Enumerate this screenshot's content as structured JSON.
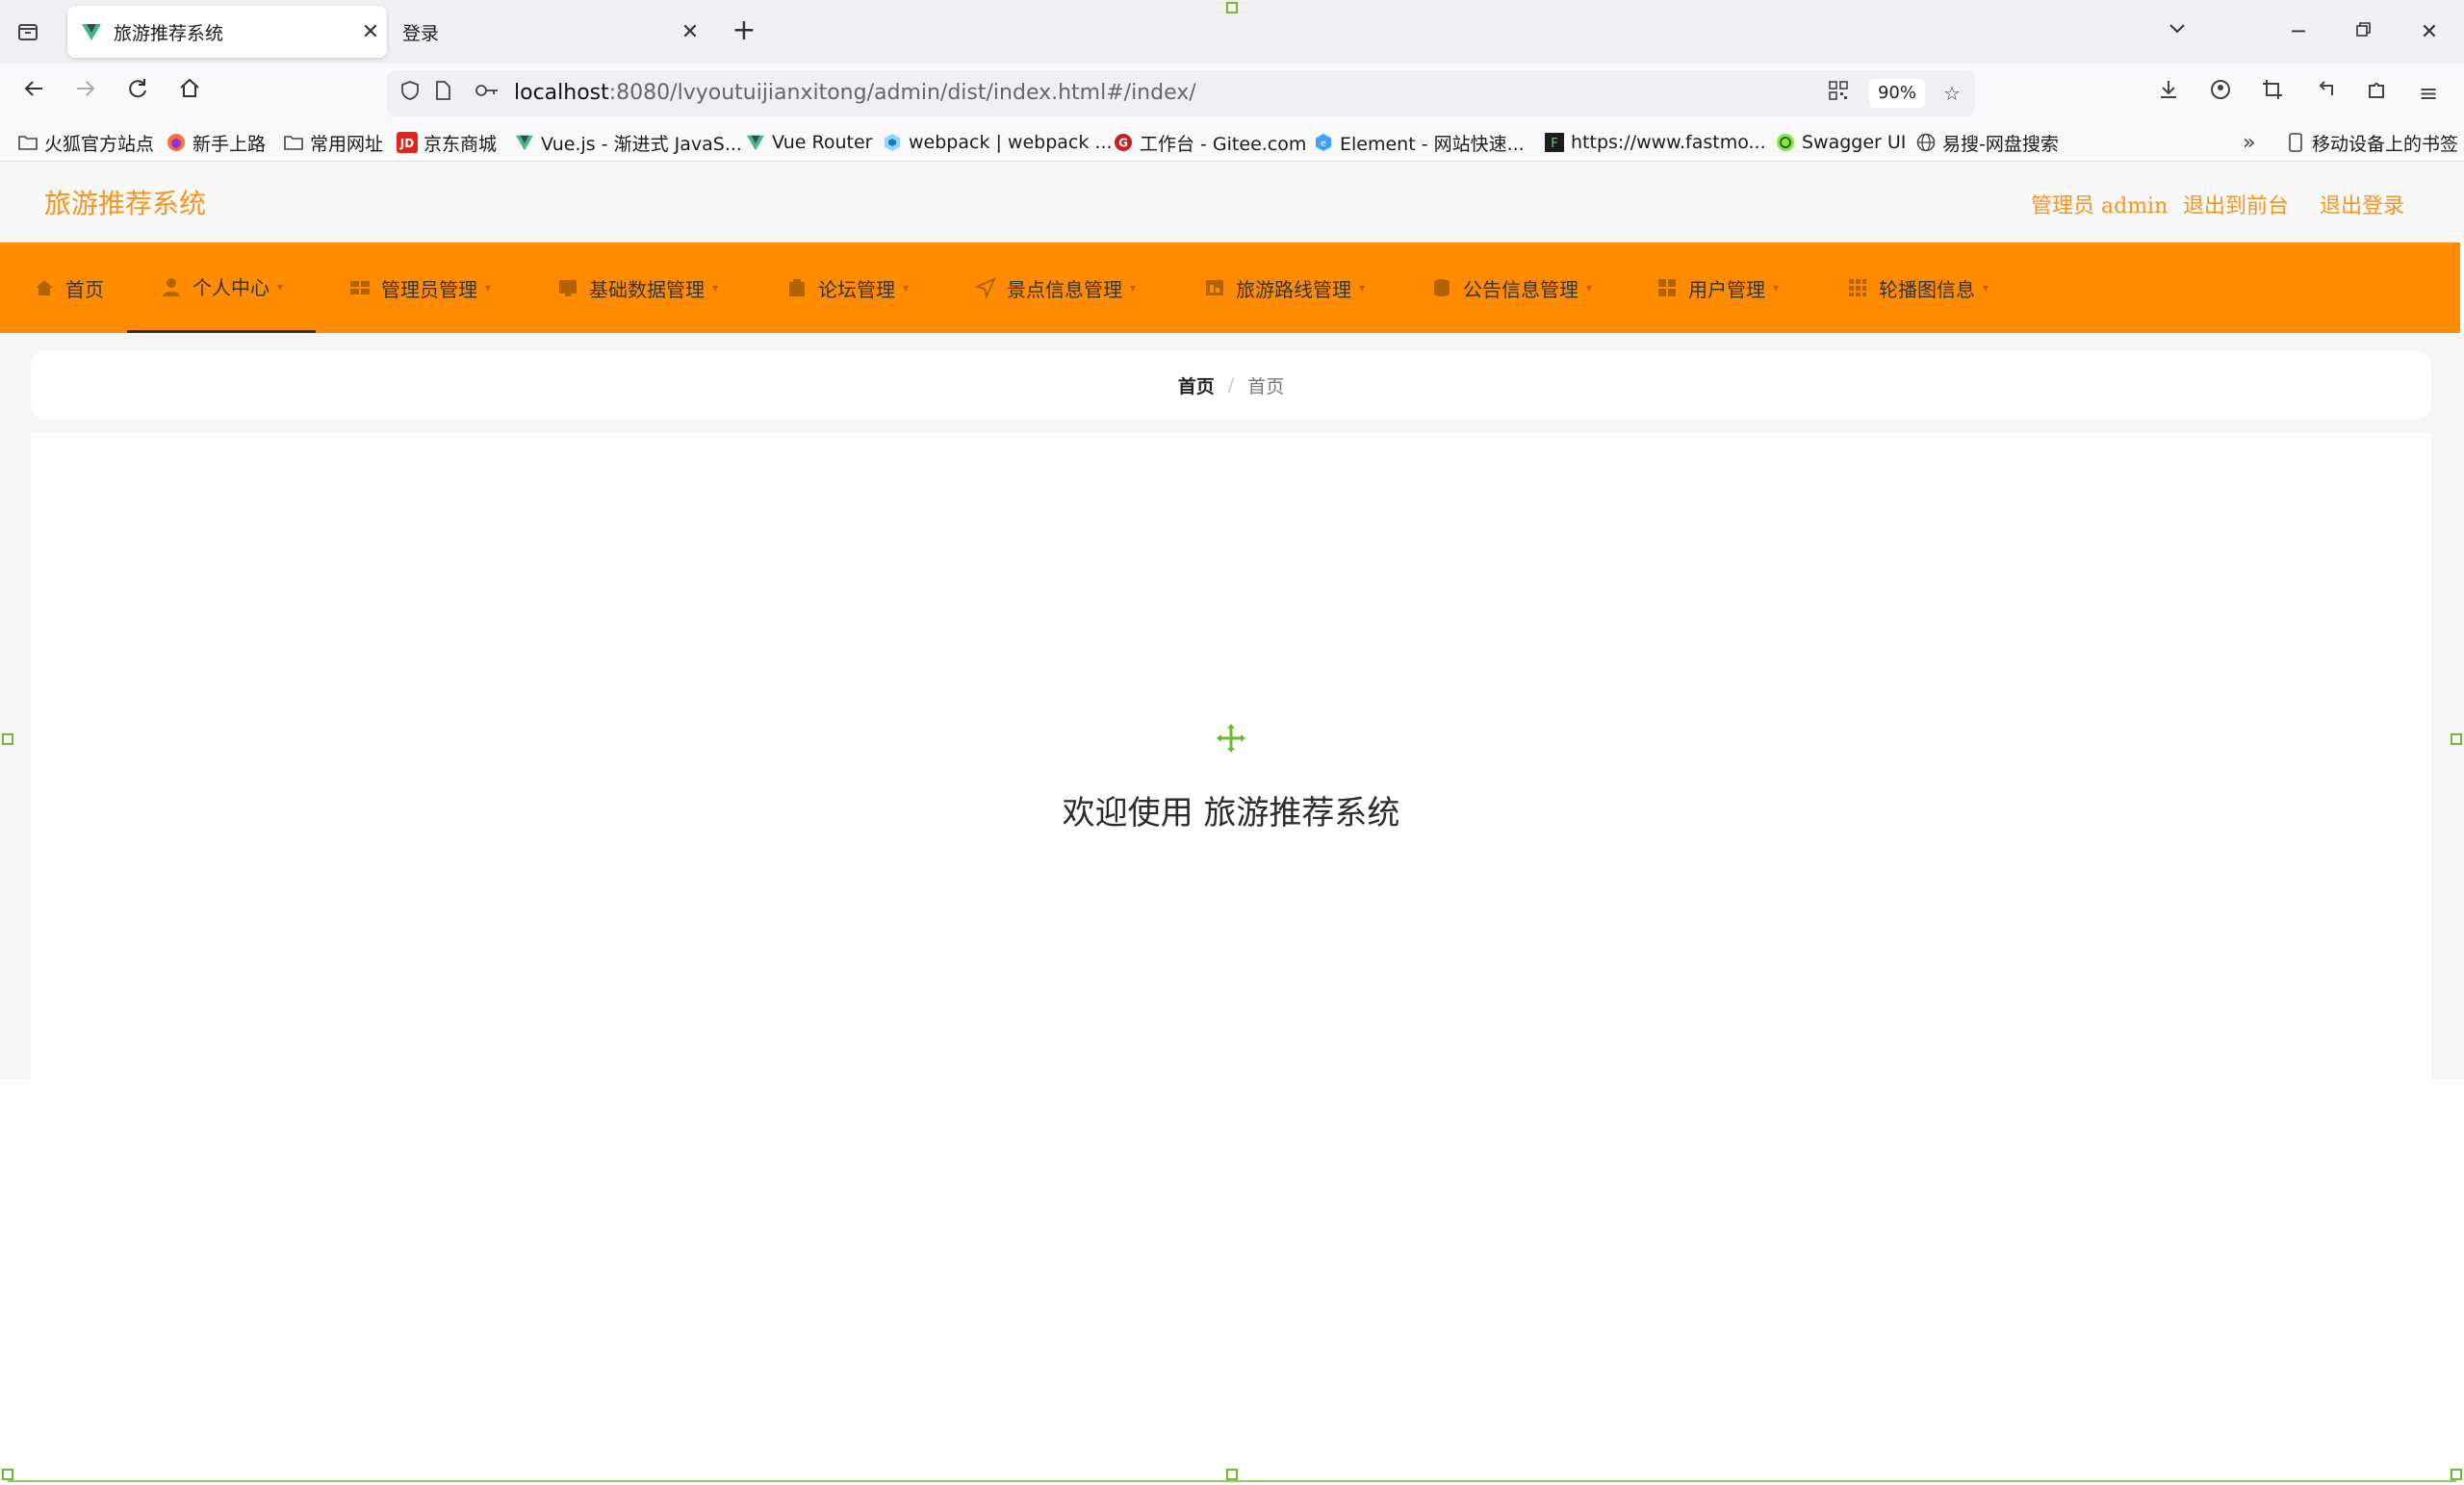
{
  "browser": {
    "tabs": [
      {
        "title": "旅游推荐系统",
        "active": true
      },
      {
        "title": "登录",
        "active": false
      }
    ],
    "url": {
      "host": "localhost",
      "path": ":8080/lvyoutuijianxitong/admin/dist/index.html#/index/"
    },
    "zoom": "90%",
    "bookmarks": [
      {
        "label": "火狐官方站点",
        "icon": "folder-icon"
      },
      {
        "label": "新手上路",
        "icon": "firefox-icon"
      },
      {
        "label": "常用网址",
        "icon": "folder-icon"
      },
      {
        "label": "京东商城",
        "icon": "jd-icon"
      },
      {
        "label": "Vue.js - 渐进式 JavaS...",
        "icon": "vue-icon"
      },
      {
        "label": "Vue Router",
        "icon": "vue-icon"
      },
      {
        "label": "webpack | webpack ...",
        "icon": "webpack-icon"
      },
      {
        "label": "工作台 - Gitee.com",
        "icon": "gitee-icon"
      },
      {
        "label": "Element - 网站快速...",
        "icon": "element-icon"
      },
      {
        "label": "https://www.fastmo...",
        "icon": "fastmock-icon"
      },
      {
        "label": "Swagger UI",
        "icon": "swagger-icon"
      },
      {
        "label": "易搜-网盘搜索",
        "icon": "globe-icon"
      }
    ],
    "mobile_bookmarks": "移动设备上的书签"
  },
  "app": {
    "brand": "旅游推荐系统",
    "header_links": {
      "user": "管理员 admin",
      "front": "退出到前台",
      "logout": "退出登录"
    },
    "menu": [
      {
        "label": "首页",
        "icon": "home-icon",
        "has_caret": false
      },
      {
        "label": "个人中心",
        "icon": "user-icon",
        "has_caret": true,
        "active": true
      },
      {
        "label": "管理员管理",
        "icon": "admin-icon",
        "has_caret": true
      },
      {
        "label": "基础数据管理",
        "icon": "data-icon",
        "has_caret": true
      },
      {
        "label": "论坛管理",
        "icon": "forum-icon",
        "has_caret": true
      },
      {
        "label": "景点信息管理",
        "icon": "location-icon",
        "has_caret": true
      },
      {
        "label": "旅游路线管理",
        "icon": "route-icon",
        "has_caret": true
      },
      {
        "label": "公告信息管理",
        "icon": "notice-icon",
        "has_caret": true
      },
      {
        "label": "用户管理",
        "icon": "users-icon",
        "has_caret": true
      },
      {
        "label": "轮播图信息",
        "icon": "carousel-icon",
        "has_caret": true
      }
    ],
    "breadcrumb": [
      "首页",
      "首页"
    ],
    "welcome": "欢迎使用 旅游推荐系统",
    "colors": {
      "accent": "#ff8c00",
      "brand_text": "#f7931e"
    }
  }
}
